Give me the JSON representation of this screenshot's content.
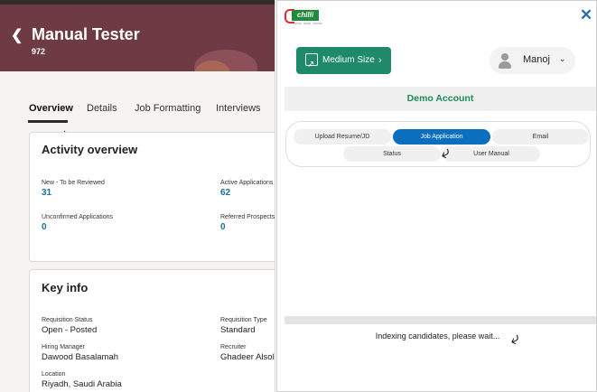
{
  "left_panel": {
    "header": {
      "title": "Manual Tester",
      "subtitle": "972",
      "back_icon": "chevron-left-icon"
    },
    "tabs": [
      {
        "label": "Overview",
        "active": true
      },
      {
        "label": "Details",
        "active": false
      },
      {
        "label": "Job Formatting",
        "active": false
      },
      {
        "label": "Interviews",
        "active": false
      }
    ],
    "activity": {
      "title": "Activity overview",
      "items": [
        {
          "label": "New - To be Reviewed",
          "value": "31"
        },
        {
          "label": "Active Applications",
          "value": "62"
        },
        {
          "label": "Unconfirmed Applications",
          "value": "0"
        },
        {
          "label": "Referred Prospects",
          "value": "0"
        }
      ]
    },
    "key_info": {
      "title": "Key info",
      "items": [
        {
          "label": "Requisition Status",
          "value": "Open - Posted"
        },
        {
          "label": "Requisition Type",
          "value": "Standard"
        },
        {
          "label": "Hiring Manager",
          "value": "Dawood Basalamah"
        },
        {
          "label": "Recruiter",
          "value": "Ghadeer Alsol"
        },
        {
          "label": "Location",
          "value": "Riyadh, Saudi Arabia"
        }
      ]
    }
  },
  "right_panel": {
    "logo": {
      "text": "chilli",
      "tagline": "THINK. HIRE. GROW."
    },
    "close_icon": "close-icon",
    "medium_button": {
      "label": "Medium Size",
      "icon": "expand-icon"
    },
    "user": {
      "name": "Manoj",
      "icon": "avatar-icon"
    },
    "account_title": "Demo Account",
    "menu": [
      {
        "label": "Upload Resume/JD",
        "active": false
      },
      {
        "label": "Job Application",
        "active": true
      },
      {
        "label": "Email",
        "active": false
      },
      {
        "label": "Status",
        "active": false
      },
      {
        "label": "User Manual",
        "active": false
      }
    ],
    "indexing_text": "Indexing candidates, please wait..."
  },
  "colors": {
    "banner": "#6e3b45",
    "link_blue": "#1e6f9a",
    "chilli_green": "#1f8a6a",
    "active_menu": "#0b6fc0",
    "account_green": "#1f8a5a"
  }
}
